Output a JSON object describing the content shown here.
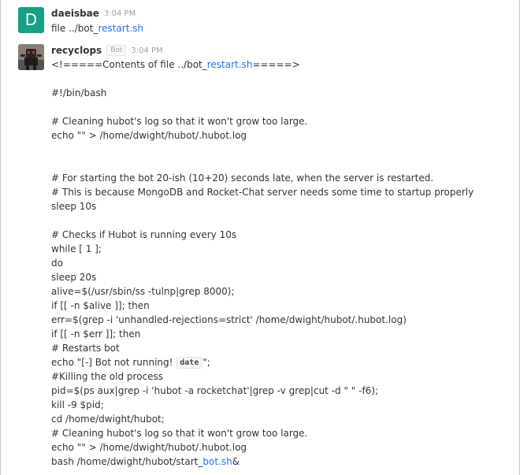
{
  "messages": [
    {
      "avatar_letter": "D",
      "username": "daeisbae",
      "time": "3:04 PM",
      "text_prefix": "file ../bot_",
      "text_link": "restart.sh"
    },
    {
      "username": "recyclops",
      "role": "Bot",
      "time": "3:04 PM",
      "header_prefix": "<!=====Contents of file ../bot_",
      "header_link": "restart.sh",
      "header_suffix": "=====>",
      "lines": {
        "shebang": "#!/bin/bash",
        "c_clean1": "# Cleaning hubot's log so that it won't grow too large.",
        "echo1": "echo \"\" > /home/dwight/hubot/.hubot.log",
        "c_start1": "# For starting the bot 20-ish (10+20) seconds late, when the server is restarted.",
        "c_start2": "# This is because MongoDB and Rocket-Chat server needs some time to startup properly",
        "sleep10": "sleep 10s",
        "c_check": "# Checks if Hubot is running every 10s",
        "while": "while [ 1 ];",
        "do": "do",
        "sleep20": "sleep 20s",
        "alive": "alive=$(/usr/sbin/ss -tulnp|grep 8000);",
        "if_alive": "if [[ -n $alive ]]; then",
        "err": "err=$(grep -i 'unhandled-rejections=strict' /home/dwight/hubot/.hubot.log)",
        "if_err": "if [[ -n $err ]]; then",
        "c_restart": "# Restarts bot",
        "echo_prefix": "echo \"[-] Bot not running! ",
        "echo_code": "date",
        "echo_suffix": "\";",
        "c_kill": "#Killing the old process",
        "pid": "pid=$(ps aux|grep -i 'hubot -a rocketchat'|grep -v grep|cut -d \" \" -f6);",
        "kill": "kill -9 $pid;",
        "cd": "cd /home/dwight/hubot;",
        "c_clean2": "# Cleaning hubot's log so that it won't grow too large.",
        "echo2": "echo \"\" > /home/dwight/hubot/.hubot.log",
        "bash_prefix": "bash /home/dwight/hubot/start_",
        "bash_link": "bot.sh",
        "bash_suffix": "&"
      }
    }
  ]
}
